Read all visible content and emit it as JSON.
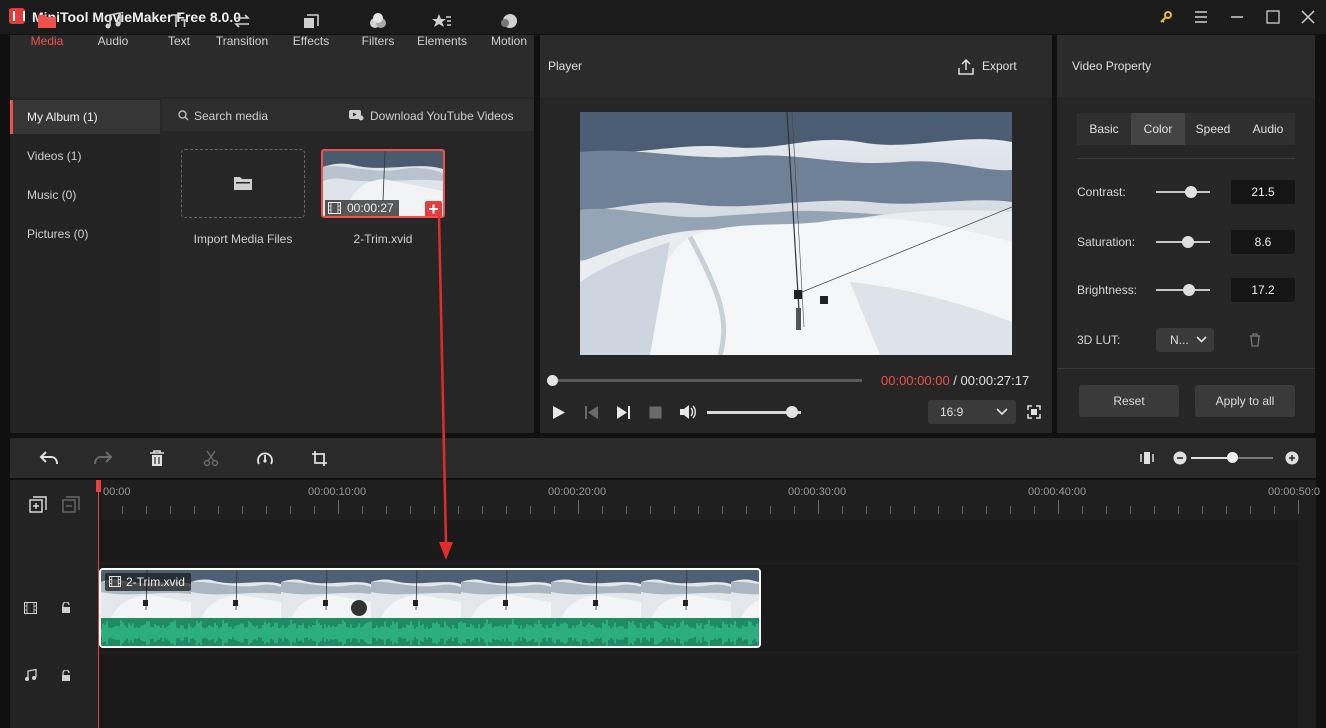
{
  "window": {
    "title": "MiniTool MovieMaker Free 8.0.0",
    "controls": [
      "key-icon",
      "menu-icon",
      "minimize-icon",
      "maximize-icon",
      "close-icon"
    ]
  },
  "toolbar": {
    "tabs": [
      {
        "label": "Media",
        "icon": "media-folder-icon",
        "active": true
      },
      {
        "label": "Audio",
        "icon": "music-note-icon"
      },
      {
        "label": "Text",
        "icon": "text-icon"
      },
      {
        "label": "Transition",
        "icon": "transition-arrows-icon"
      },
      {
        "label": "Effects",
        "icon": "effects-icon"
      },
      {
        "label": "Filters",
        "icon": "filters-icon"
      },
      {
        "label": "Elements",
        "icon": "elements-icon"
      },
      {
        "label": "Motion",
        "icon": "motion-icon"
      }
    ]
  },
  "album": {
    "items": [
      {
        "label": "My Album (1)",
        "active": true
      },
      {
        "label": "Videos (1)"
      },
      {
        "label": "Music (0)"
      },
      {
        "label": "Pictures (0)"
      }
    ]
  },
  "media": {
    "search_label": "Search media",
    "download_label": "Download YouTube Videos",
    "import_label": "Import Media Files",
    "clip_name": "2-Trim.xvid",
    "clip_duration": "00:00:27"
  },
  "player": {
    "title": "Player",
    "export_label": "Export",
    "current_time": "00:00:00:00",
    "separator": " / ",
    "total_time": "00:00:27:17",
    "aspect_ratio": "16:9",
    "seek_progress": 0,
    "volume_level": 0.9
  },
  "property": {
    "title": "Video Property",
    "tabs": [
      {
        "label": "Basic"
      },
      {
        "label": "Color",
        "active": true
      },
      {
        "label": "Speed"
      },
      {
        "label": "Audio"
      }
    ],
    "contrast": {
      "label": "Contrast:",
      "value": "21.5",
      "level": 0.65
    },
    "saturation": {
      "label": "Saturation:",
      "value": "8.6",
      "level": 0.6
    },
    "brightness": {
      "label": "Brightness:",
      "value": "17.2",
      "level": 0.62
    },
    "lut": {
      "label": "3D LUT:",
      "value": "N..."
    },
    "reset_label": "Reset",
    "apply_all_label": "Apply to all"
  },
  "timeline": {
    "ruler": [
      "00:00",
      "00:00:10:00",
      "00:00:20:00",
      "00:00:30:00",
      "00:00:40:00",
      "00:00:50:0"
    ],
    "clip_label": "2-Trim.xvid",
    "zoom_level": 0.5
  },
  "colors": {
    "accent": "#f0504e",
    "audio_wave": "#3ad39a",
    "audio_bg": "#1f8a63"
  }
}
